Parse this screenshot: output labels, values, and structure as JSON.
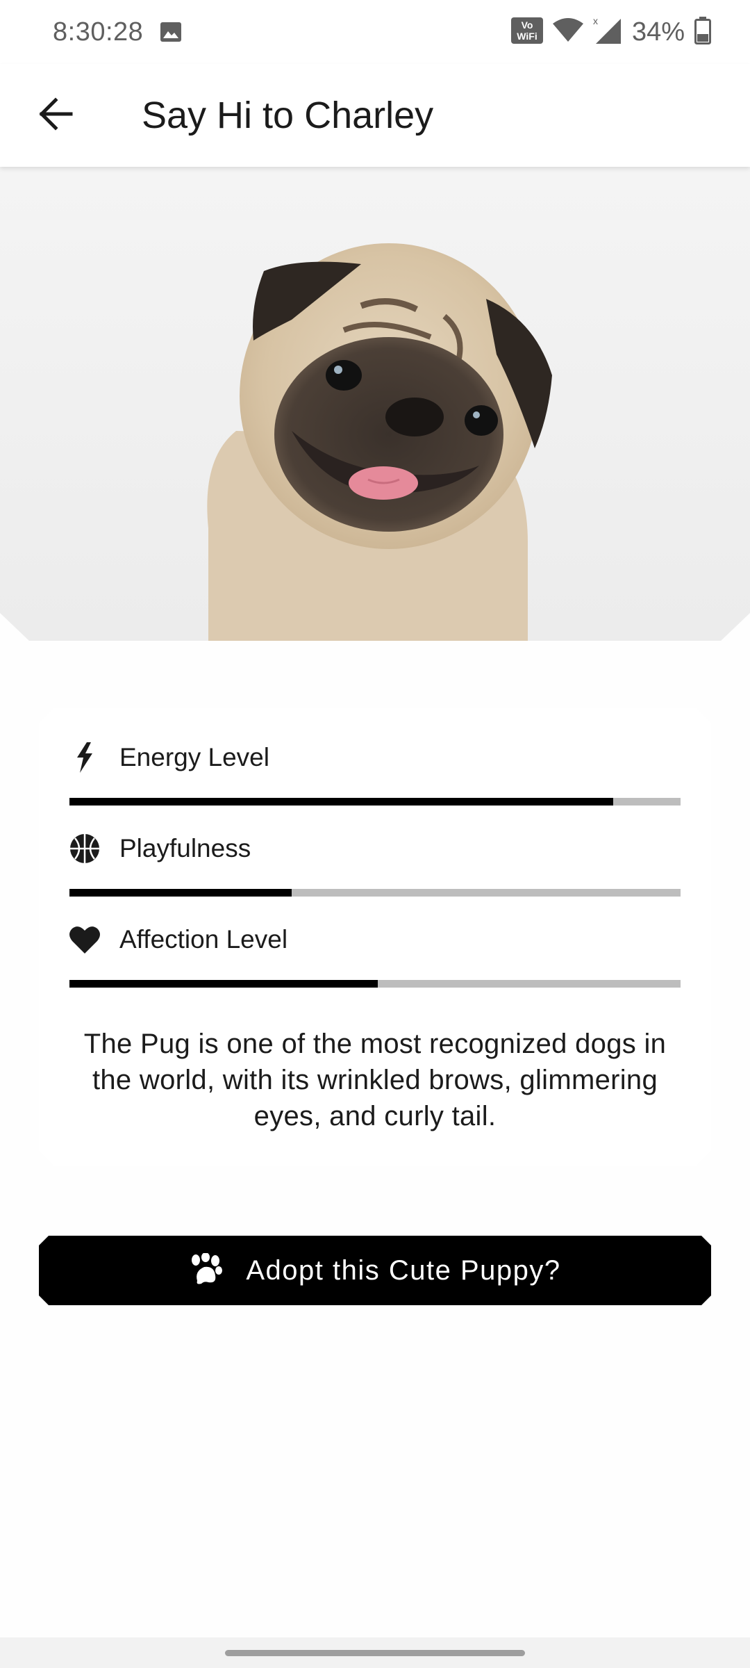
{
  "status_bar": {
    "time": "8:30:28",
    "battery": "34%",
    "icons": [
      "gallery-icon",
      "vowifi-icon",
      "wifi-icon",
      "signal-icon",
      "battery-icon"
    ]
  },
  "app_bar": {
    "title": "Say Hi to Charley",
    "back_icon": "arrow-back-icon"
  },
  "hero": {
    "subject": "pug-photo"
  },
  "traits": [
    {
      "label": "Energy Level",
      "icon": "lightning-icon",
      "level": 0.89
    },
    {
      "label": "Playfulness",
      "icon": "basketball-icon",
      "level": 0.364
    },
    {
      "label": "Affection Level",
      "icon": "heart-icon",
      "level": 0.504
    }
  ],
  "description": "The Pug is one of the most recognized dogs in the world, with its wrinkled brows, glimmering eyes, and curly tail.",
  "adopt_button": {
    "label": "Adopt this Cute Puppy?",
    "icon": "paw-icon"
  },
  "colors": {
    "accent": "#000000",
    "bar_track": "#bdbdbd",
    "background": "#fefefe"
  }
}
